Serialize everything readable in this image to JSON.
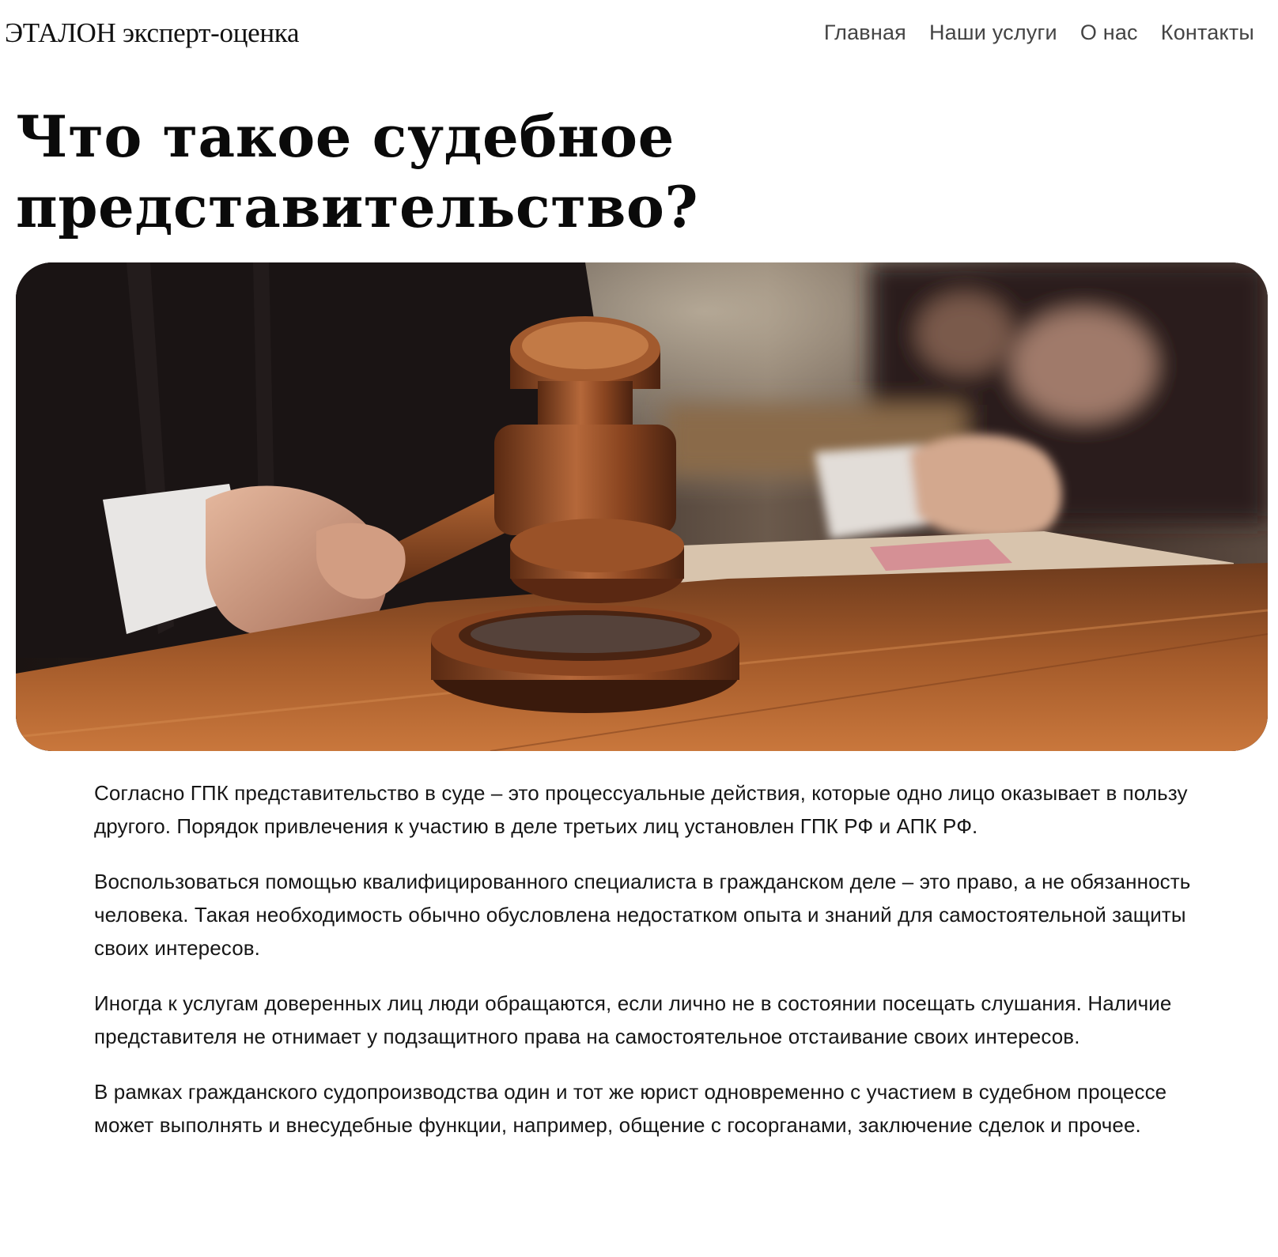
{
  "header": {
    "logo": "ЭТАЛОН эксперт-оценка",
    "nav": [
      "Главная",
      "Наши услуги",
      "О нас",
      "Контакты"
    ]
  },
  "article": {
    "title": "Что такое судебное представительство?",
    "hero_image": "judge-gavel-photo",
    "paragraphs": [
      "Согласно ГПК представительство в суде – это процессуальные действия, которые одно лицо оказывает в пользу другого. Порядок привлечения к участию в деле третьих лиц установлен ГПК РФ и АПК РФ.",
      "Воспользоваться помощью квалифицированного специалиста в гражданском деле – это право, а не обязанность человека. Такая необходимость обычно обусловлена недостатком опыта и знаний для самостоятельной защиты своих интересов.",
      "Иногда к услугам доверенных лиц люди обращаются, если лично не в состоянии посещать слушания. Наличие представителя не отнимает у подзащитного права на самостоятельное отстаивание своих интересов.",
      "В рамках гражданского судопроизводства один и тот же юрист одновременно с участием в судебном процессе может выполнять и внесудебные функции, например, общение с госорганами, заключение сделок и прочее."
    ]
  }
}
